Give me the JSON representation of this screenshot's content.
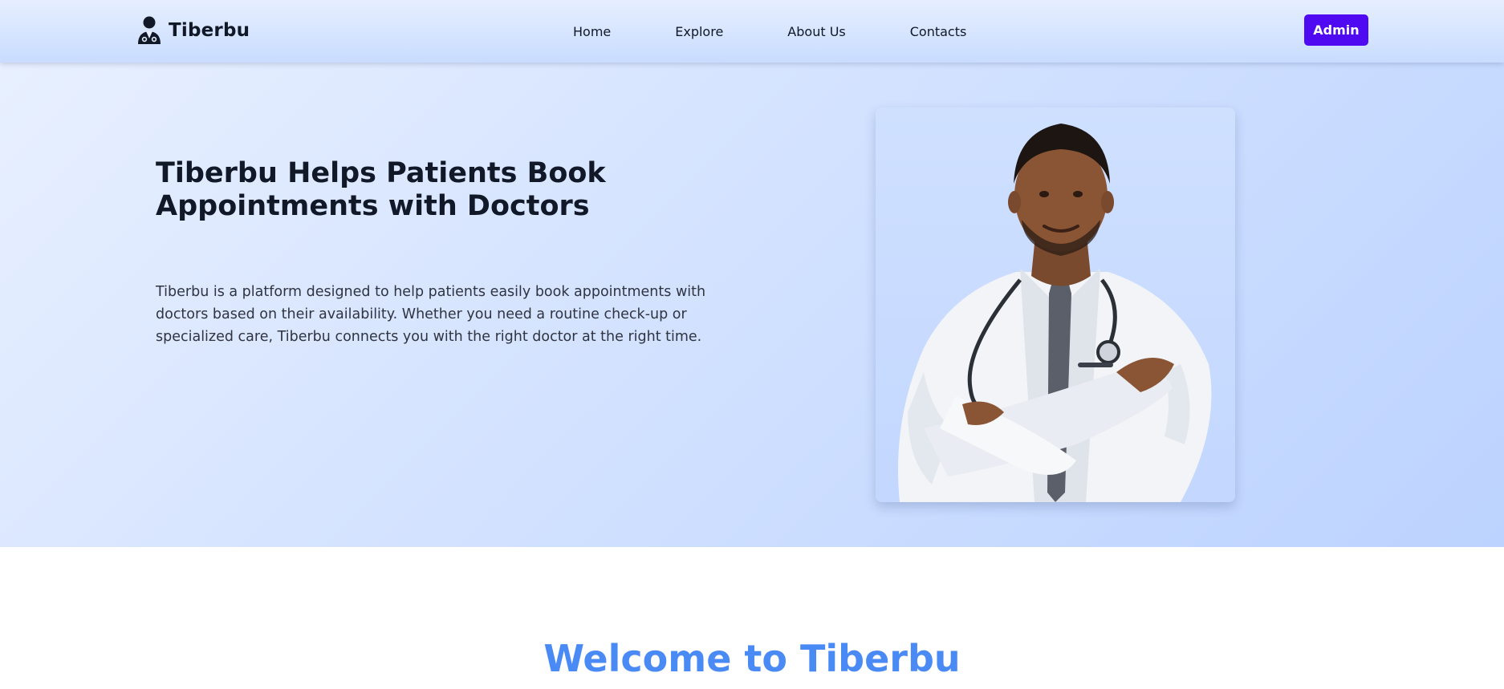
{
  "header": {
    "brand_name": "Tiberbu",
    "brand_icon": "doctor-icon",
    "nav": [
      {
        "label": "Home"
      },
      {
        "label": "Explore"
      },
      {
        "label": "About Us"
      },
      {
        "label": "Contacts"
      }
    ],
    "admin_label": "Admin",
    "admin_color": "#4f0af2"
  },
  "hero": {
    "title": "Tiberbu Helps Patients Book Appointments with Doctors",
    "description": "Tiberbu is a platform designed to help patients easily book appointments with doctors based on their availability. Whether you need a routine check-up or specialized care, Tiberbu connects you with the right doctor at the right time.",
    "image": "doctor-portrait"
  },
  "welcome": {
    "title": "Welcome to Tiberbu",
    "color": "#4a8af5"
  }
}
